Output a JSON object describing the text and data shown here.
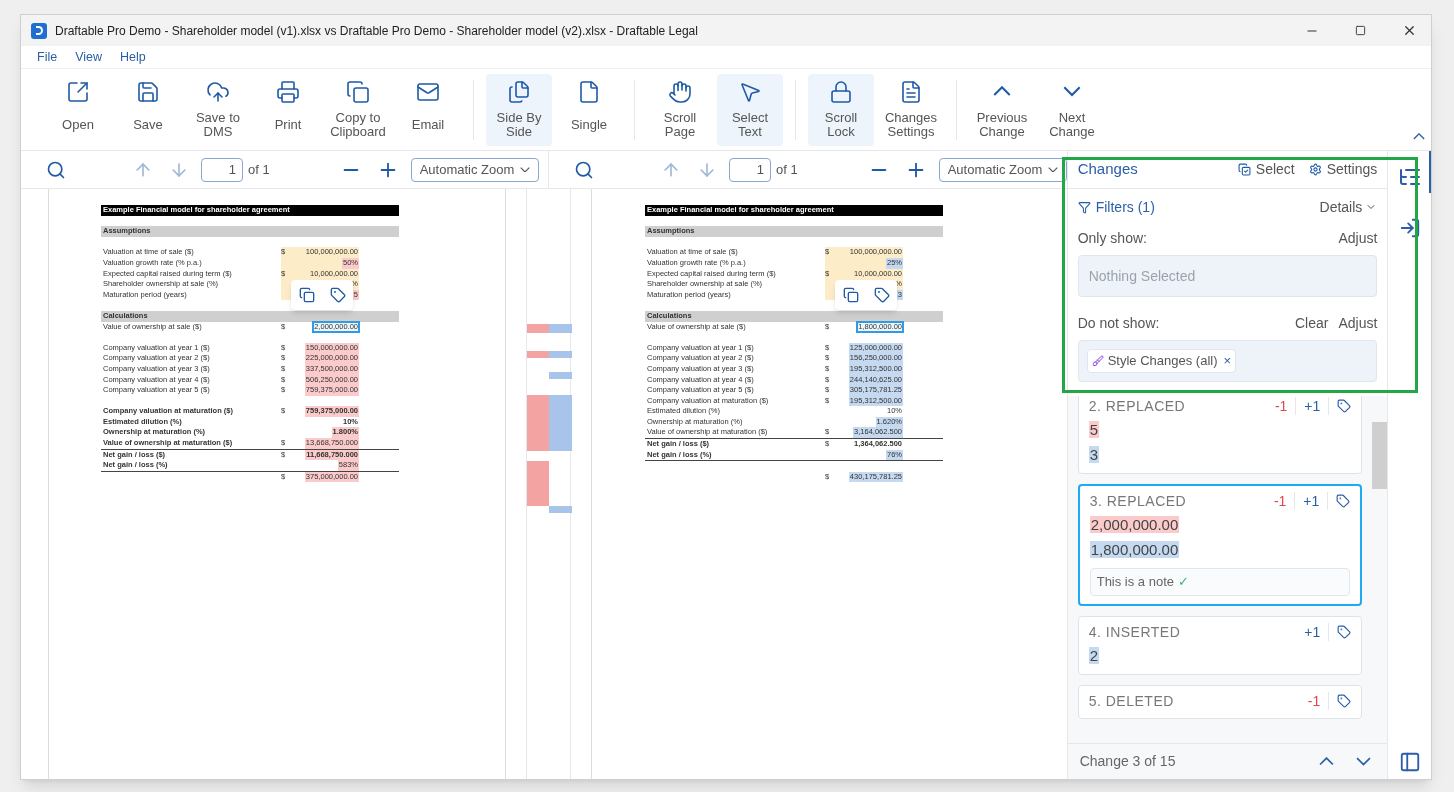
{
  "window": {
    "title": "Draftable Pro Demo - Shareholder model (v1).xlsx vs Draftable Pro Demo - Shareholder model (v2).xlsx - Draftable Legal"
  },
  "menu": [
    "File",
    "View",
    "Help"
  ],
  "toolbar": [
    [
      {
        "label": "Open",
        "selected": false
      },
      {
        "label": "Save",
        "selected": false
      },
      {
        "label": "Save to DMS",
        "selected": false
      },
      {
        "label": "Print",
        "selected": false
      },
      {
        "label": "Copy to Clipboard",
        "selected": false
      },
      {
        "label": "Email",
        "selected": false
      }
    ],
    [
      {
        "label": "Side By Side",
        "selected": true
      },
      {
        "label": "Single",
        "selected": false
      }
    ],
    [
      {
        "label": "Scroll Page",
        "selected": false
      },
      {
        "label": "Select Text",
        "selected": true
      }
    ],
    [
      {
        "label": "Scroll Lock",
        "selected": true
      },
      {
        "label": "Changes Settings",
        "selected": false
      }
    ],
    [
      {
        "label": "Previous Change",
        "selected": false
      },
      {
        "label": "Next Change",
        "selected": false
      }
    ]
  ],
  "viewers": [
    {
      "kind": "original",
      "page": "1",
      "of": "of 1",
      "zoom": "Automatic Zoom",
      "rows": [
        {
          "kind": "title",
          "label": "Example Financial model for shareholder agreement"
        },
        {
          "kind": "blank"
        },
        {
          "kind": "section",
          "label": "Assumptions"
        },
        {
          "kind": "blank"
        },
        {
          "kind": "item",
          "label": "Valuation at time of sale ($)",
          "currency": "$",
          "value": "100,000,000.00",
          "input": true,
          "bold": false,
          "rule": false,
          "changed": false,
          "selected": false
        },
        {
          "kind": "item",
          "label": "Valuation growth rate (% p.a.)",
          "value": "50%",
          "input": true,
          "bold": false,
          "rule": false,
          "changed": true,
          "selected": false
        },
        {
          "kind": "item",
          "label": "Expected capital raised during term ($)",
          "currency": "$",
          "value": "10,000,000.00",
          "input": true,
          "bold": false,
          "rule": false,
          "changed": false,
          "selected": false
        },
        {
          "kind": "item",
          "label": "Shareholder ownership at sale (%)",
          "value": "%",
          "input": true,
          "bold": false,
          "rule": false,
          "changed": false,
          "selected": false
        },
        {
          "kind": "item",
          "label": "Maturation period (years)",
          "value": "5",
          "input": true,
          "bold": false,
          "rule": false,
          "changed": true,
          "selected": false
        },
        {
          "kind": "blank"
        },
        {
          "kind": "section",
          "label": "Calculations"
        },
        {
          "kind": "item",
          "label": "Value of ownership at sale ($)",
          "currency": "$",
          "value": "2,000,000.00",
          "input": false,
          "bold": false,
          "rule": false,
          "changed": true,
          "selected": true
        },
        {
          "kind": "blank"
        },
        {
          "kind": "item",
          "label": "Company valuation at year 1 ($)",
          "currency": "$",
          "value": "150,000,000.00",
          "input": false,
          "bold": false,
          "rule": false,
          "changed": true,
          "selected": false
        },
        {
          "kind": "item",
          "label": "Company valuation at year 2 ($)",
          "currency": "$",
          "value": "225,000,000.00",
          "input": false,
          "bold": false,
          "rule": false,
          "changed": true,
          "selected": false
        },
        {
          "kind": "item",
          "label": "Company valuation at year 3 ($)",
          "currency": "$",
          "value": "337,500,000.00",
          "input": false,
          "bold": false,
          "rule": false,
          "changed": true,
          "selected": false
        },
        {
          "kind": "item",
          "label": "Company valuation at year 4 ($)",
          "currency": "$",
          "value": "506,250,000.00",
          "input": false,
          "bold": false,
          "rule": false,
          "changed": true,
          "selected": false
        },
        {
          "kind": "item",
          "label": "Company valuation at year 5 ($)",
          "currency": "$",
          "value": "759,375,000.00",
          "input": false,
          "bold": false,
          "rule": false,
          "changed": true,
          "selected": false
        },
        {
          "kind": "blank"
        },
        {
          "kind": "item",
          "label": "Company valuation at maturation ($)",
          "currency": "$",
          "value": "759,375,000.00",
          "input": false,
          "bold": true,
          "rule": false,
          "changed": true,
          "selected": false
        },
        {
          "kind": "item",
          "label": "Estimated dilution (%)",
          "value": "10%",
          "input": false,
          "bold": true,
          "rule": false,
          "changed": false,
          "selected": false
        },
        {
          "kind": "item",
          "label": "Ownership at maturation (%)",
          "value": "1.800%",
          "input": false,
          "bold": true,
          "rule": false,
          "changed": true,
          "selected": false
        },
        {
          "kind": "item",
          "label": "Value of ownership at maturation ($)",
          "currency": "$",
          "value": "13,668,750.000",
          "input": false,
          "bold": true,
          "rule": true,
          "changed": true,
          "selected": false
        },
        {
          "kind": "item",
          "label": "Net gain / loss ($)",
          "currency": "$",
          "value": "11,668,750.000",
          "input": false,
          "bold": true,
          "rule": false,
          "changed": true,
          "selected": false
        },
        {
          "kind": "item",
          "label": "Net gain / loss (%)",
          "value": "583%",
          "input": false,
          "bold": true,
          "rule": true,
          "changed": true,
          "selected": false
        },
        {
          "kind": "item",
          "currency": "$",
          "value": "375,000,000.00",
          "input": false,
          "bold": false,
          "rule": false,
          "changed": true,
          "selected": false
        }
      ]
    },
    {
      "kind": "revised",
      "page": "1",
      "of": "of 1",
      "zoom": "Automatic Zoom",
      "rows": [
        {
          "kind": "title",
          "label": "Example Financial model for shareholder agreement"
        },
        {
          "kind": "blank"
        },
        {
          "kind": "section",
          "label": "Assumptions"
        },
        {
          "kind": "blank"
        },
        {
          "kind": "item",
          "label": "Valuation at time of sale ($)",
          "currency": "$",
          "value": "100,000,000.00",
          "input": true,
          "bold": false,
          "rule": false,
          "changed": false,
          "selected": false
        },
        {
          "kind": "item",
          "label": "Valuation growth rate (% p.a.)",
          "value": "25%",
          "input": true,
          "bold": false,
          "rule": false,
          "changed": true,
          "selected": false
        },
        {
          "kind": "item",
          "label": "Expected capital raised during term ($)",
          "currency": "$",
          "value": "10,000,000.00",
          "input": true,
          "bold": false,
          "rule": false,
          "changed": false,
          "selected": false
        },
        {
          "kind": "item",
          "label": "Shareholder ownership at sale (%)",
          "value": "%",
          "input": true,
          "bold": false,
          "rule": false,
          "changed": false,
          "selected": false
        },
        {
          "kind": "item",
          "label": "Maturation period (years)",
          "value": "3",
          "input": true,
          "bold": false,
          "rule": false,
          "changed": true,
          "selected": false
        },
        {
          "kind": "blank"
        },
        {
          "kind": "section",
          "label": "Calculations"
        },
        {
          "kind": "item",
          "label": "Value of ownership at sale ($)",
          "currency": "$",
          "value": "1,800,000.00",
          "input": false,
          "bold": false,
          "rule": false,
          "changed": true,
          "selected": true
        },
        {
          "kind": "blank"
        },
        {
          "kind": "item",
          "label": "Company valuation at year 1 ($)",
          "currency": "$",
          "value": "125,000,000.00",
          "input": false,
          "bold": false,
          "rule": false,
          "changed": true,
          "selected": false
        },
        {
          "kind": "item",
          "label": "Company valuation at year 2 ($)",
          "currency": "$",
          "value": "156,250,000.00",
          "input": false,
          "bold": false,
          "rule": false,
          "changed": true,
          "selected": false
        },
        {
          "kind": "item",
          "label": "Company valuation at year 3 ($)",
          "currency": "$",
          "value": "195,312,500.00",
          "input": false,
          "bold": false,
          "rule": false,
          "changed": true,
          "selected": false
        },
        {
          "kind": "item",
          "label": "Company valuation at year 4 ($)",
          "currency": "$",
          "value": "244,140,625.00",
          "input": false,
          "bold": false,
          "rule": false,
          "changed": true,
          "selected": false
        },
        {
          "kind": "item",
          "label": "Company valuation at year 5 ($)",
          "currency": "$",
          "value": "305,175,781.25",
          "input": false,
          "bold": false,
          "rule": false,
          "changed": true,
          "selected": false
        },
        {
          "kind": "item",
          "label": "Company valuation at maturation ($)",
          "currency": "$",
          "value": "195,312,500.00",
          "input": false,
          "bold": false,
          "rule": false,
          "changed": true,
          "selected": false
        },
        {
          "kind": "item",
          "label": "Estimated dilution (%)",
          "value": "10%",
          "input": false,
          "bold": false,
          "rule": false,
          "changed": false,
          "selected": false
        },
        {
          "kind": "item",
          "label": "Ownership at maturation (%)",
          "value": "1.620%",
          "input": false,
          "bold": false,
          "rule": false,
          "changed": true,
          "selected": false
        },
        {
          "kind": "item",
          "label": "Value of ownership at maturation ($)",
          "currency": "$",
          "value": "3,164,062.500",
          "input": false,
          "bold": false,
          "rule": true,
          "changed": true,
          "selected": false
        },
        {
          "kind": "item",
          "label": "Net gain / loss ($)",
          "currency": "$",
          "value": "1,364,062.500",
          "input": false,
          "bold": true,
          "rule": false,
          "changed": false,
          "selected": false
        },
        {
          "kind": "item",
          "label": "Net gain / loss (%)",
          "value": "76%",
          "input": false,
          "bold": true,
          "rule": true,
          "changed": true,
          "selected": false
        },
        {
          "kind": "blank"
        },
        {
          "kind": "item",
          "currency": "$",
          "value": "430,175,781.25",
          "input": false,
          "bold": false,
          "rule": false,
          "changed": true,
          "selected": false
        }
      ]
    }
  ],
  "changes": {
    "title": "Changes",
    "select": "Select",
    "settings": "Settings",
    "filters": "Filters (1)",
    "details": "Details",
    "only_show": "Only show:",
    "only_adjust": "Adjust",
    "only_placeholder": "Nothing Selected",
    "do_not_show": "Do not show:",
    "clear": "Clear",
    "do_not_adjust": "Adjust",
    "chip": "Style Changes (all)",
    "chip_remove": "×",
    "cards": [
      {
        "title": "2. REPLACED",
        "minus": "-1",
        "plus": "+1",
        "deleted": "5",
        "inserted": "3",
        "selected": false
      },
      {
        "title": "3. REPLACED",
        "minus": "-1",
        "plus": "+1",
        "deleted": "2,000,000.00",
        "inserted": "1,800,000.00",
        "note": "This is a note",
        "note_check": "✓",
        "selected": true
      },
      {
        "title": "4. INSERTED",
        "plus": "+1",
        "inserted": "2",
        "selected": false
      },
      {
        "title": "5. DELETED",
        "minus": "-1",
        "selected": false
      }
    ],
    "footer": "Change 3 of 15"
  }
}
